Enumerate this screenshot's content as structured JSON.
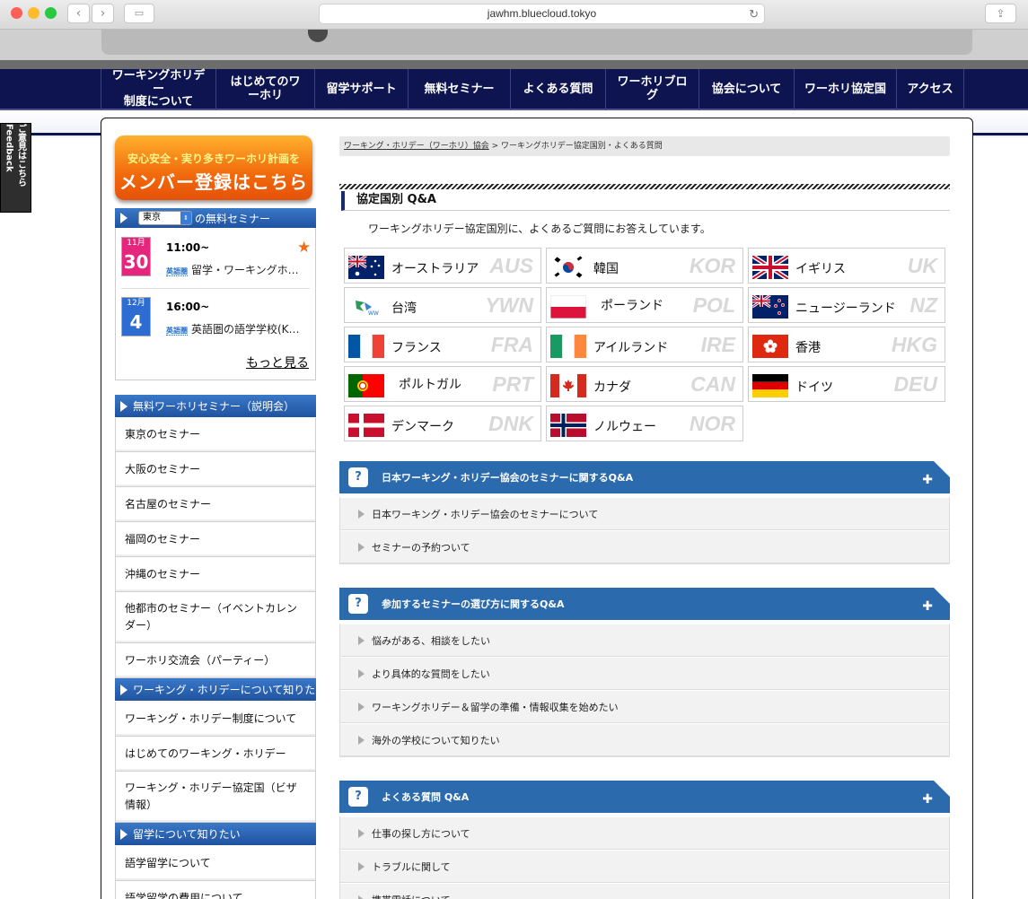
{
  "browser": {
    "url": "jawhm.bluecloud.tokyo"
  },
  "feedback": {
    "label": "ご意見はこちら Feedback"
  },
  "nav": {
    "items": [
      "ワーキングホリデー\n制度について",
      "はじめてのワーホリ",
      "留学サポート",
      "無料セミナー",
      "よくある質問",
      "ワーホリブログ",
      "協会について",
      "ワーホリ協定国",
      "アクセス"
    ]
  },
  "banner": {
    "line1": "安心安全・実り多きワーホリ計画を",
    "line2": "メンバー登録はこちら"
  },
  "seminar": {
    "region": "東京",
    "header_suffix": "の無料セミナー",
    "events": [
      {
        "month": "11月",
        "day": "30",
        "time": "11:00~",
        "tag": "英語圏",
        "title": "留学・ワーキングホ…"
      },
      {
        "month": "12月",
        "day": "4",
        "time": "16:00~",
        "tag": "英語圏",
        "title": "英語圏の語学学校(K…"
      }
    ],
    "more": "もっと見る"
  },
  "sidebar": {
    "sections": [
      {
        "title": "無料ワーホリセミナー（説明会）",
        "items": [
          "東京のセミナー",
          "大阪のセミナー",
          "名古屋のセミナー",
          "福岡のセミナー",
          "沖縄のセミナー",
          "他都市のセミナー（イベントカレンダー）",
          "ワーホリ交流会（パーティー）"
        ]
      },
      {
        "title": "ワーキング・ホリデーについて知りたい",
        "items": [
          "ワーキング・ホリデー制度について",
          "はじめてのワーキング・ホリデー",
          "ワーキング・ホリデー協定国（ビザ情報）"
        ]
      },
      {
        "title": "留学について知りたい",
        "items": [
          "語学留学について",
          "語学留学の費用について"
        ]
      }
    ]
  },
  "breadcrumb": {
    "home": "ワーキング・ホリデー（ワーホリ）協会",
    "sep": ">",
    "current": "ワーキングホリデー協定国別・よくある質問"
  },
  "main": {
    "title": "協定国別 Q&A",
    "intro": "ワーキングホリデー協定国別に、よくあるご質問にお答えしています。",
    "countries": [
      {
        "name": "オーストラリア",
        "code": "AUS",
        "flag": "au"
      },
      {
        "name": "韓国",
        "code": "KOR",
        "flag": "kr"
      },
      {
        "name": "イギリス",
        "code": "UK",
        "flag": "uk"
      },
      {
        "name": "台湾",
        "code": "YWN",
        "flag": "tw"
      },
      {
        "name": "ポーランド",
        "code": "POL",
        "flag": "pl"
      },
      {
        "name": "ニュージーランド",
        "code": "NZ",
        "flag": "nz"
      },
      {
        "name": "フランス",
        "code": "FRA",
        "flag": "fr"
      },
      {
        "name": "アイルランド",
        "code": "IRE",
        "flag": "ie"
      },
      {
        "name": "香港",
        "code": "HKG",
        "flag": "hk"
      },
      {
        "name": "ポルトガル",
        "code": "PRT",
        "flag": "pt"
      },
      {
        "name": "カナダ",
        "code": "CAN",
        "flag": "ca"
      },
      {
        "name": "ドイツ",
        "code": "DEU",
        "flag": "de"
      },
      {
        "name": "デンマーク",
        "code": "DNK",
        "flag": "dk"
      },
      {
        "name": "ノルウェー",
        "code": "NOR",
        "flag": "no"
      }
    ],
    "qa_sections": [
      {
        "title": "日本ワーキング・ホリデー協会のセミナーに関するQ&A",
        "items": [
          "日本ワーキング・ホリデー協会のセミナーについて",
          "セミナーの予約ついて"
        ]
      },
      {
        "title": "参加するセミナーの選び方に関するQ&A",
        "items": [
          "悩みがある、相談をしたい",
          "より具体的な質問をしたい",
          "ワーキングホリデー＆留学の準備・情報収集を始めたい",
          "海外の学校について知りたい"
        ]
      },
      {
        "title": "よくある質問 Q&A",
        "items": [
          "仕事の探し方について",
          "トラブルに関して",
          "携帯電話について"
        ]
      }
    ]
  }
}
